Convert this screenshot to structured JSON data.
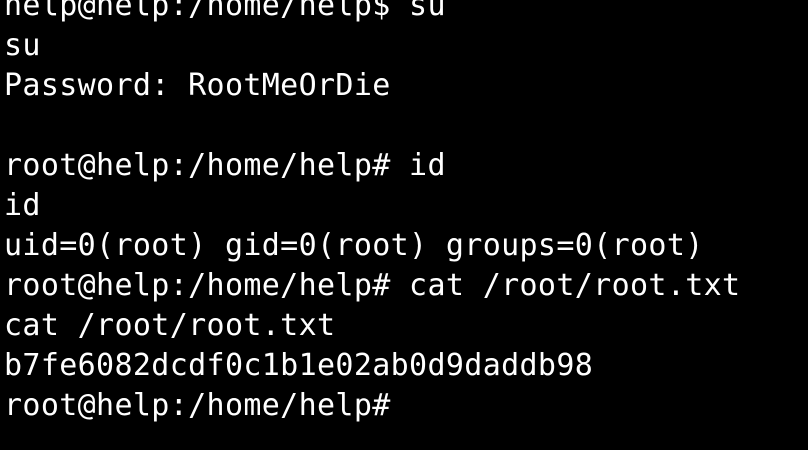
{
  "terminal": {
    "lines": [
      {
        "text": "help@help:/home/help$ su"
      },
      {
        "text": "su"
      },
      {
        "text": "Password: RootMeOrDie"
      },
      {
        "text": ""
      },
      {
        "text": "root@help:/home/help# id"
      },
      {
        "text": "id"
      },
      {
        "text": "uid=0(root) gid=0(root) groups=0(root)"
      },
      {
        "text": "root@help:/home/help# cat /root/root.txt"
      },
      {
        "text": "cat /root/root.txt"
      },
      {
        "text": "b7fe6082dcdf0c1b1e02ab0d9daddb98"
      },
      {
        "text": "root@help:/home/help#"
      }
    ]
  },
  "colors": {
    "background": "#000000",
    "foreground": "#ffffff"
  }
}
